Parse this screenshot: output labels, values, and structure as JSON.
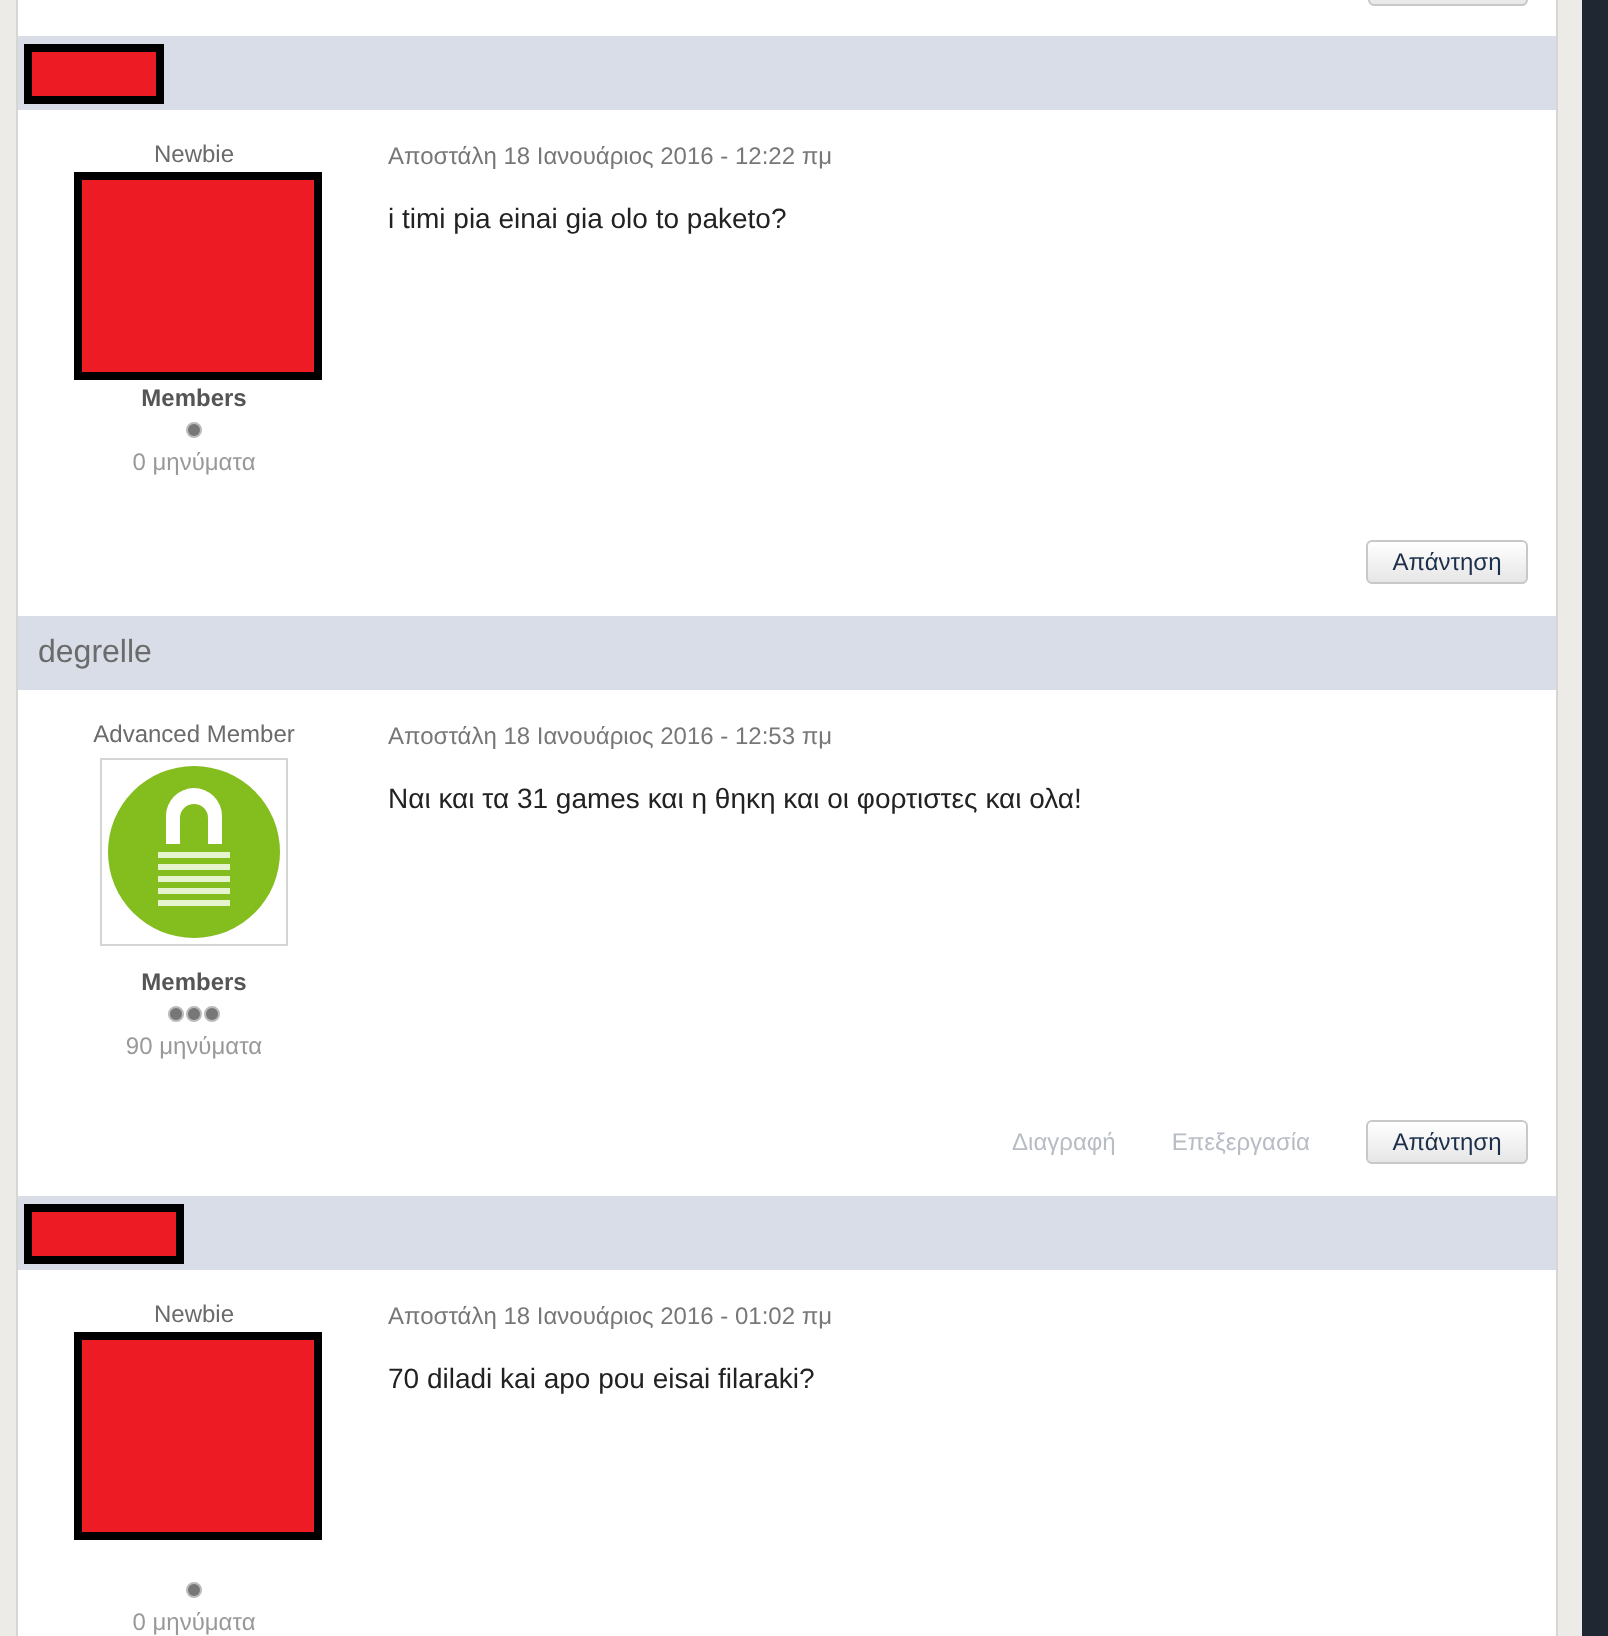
{
  "posts": [
    {
      "author": {
        "redacted": true
      },
      "rank": "Newbie",
      "avatar": {
        "kind": "redacted"
      },
      "group": "Members",
      "rank_pips": [
        {
          "kind": "dot"
        }
      ],
      "post_count": "0 μηνύματα",
      "timestamp": "Αποστάλη 18 Ιανουάριος 2016 - 12:22 πμ",
      "message": "i timi pia einai gia olo to paketo?",
      "actions": [
        {
          "kind": "button",
          "label": "Απάντηση"
        }
      ]
    },
    {
      "author": {
        "redacted": false,
        "name": "degrelle"
      },
      "rank": "Advanced Member",
      "avatar": {
        "kind": "logo"
      },
      "group": "Members",
      "rank_pips": [
        {
          "kind": "dot"
        },
        {
          "kind": "dot"
        },
        {
          "kind": "dot"
        }
      ],
      "post_count": "90 μηνύματα",
      "timestamp": "Αποστάλη 18 Ιανουάριος 2016 - 12:53 πμ",
      "message": "Ναι και τα 31 games και η θηκη και οι φορτιστες και ολα!",
      "actions": [
        {
          "kind": "link",
          "label": "Διαγραφή"
        },
        {
          "kind": "link",
          "label": "Επεξεργασία"
        },
        {
          "kind": "button",
          "label": "Απάντηση"
        }
      ]
    },
    {
      "author": {
        "redacted": true
      },
      "rank": "Newbie",
      "avatar": {
        "kind": "redacted"
      },
      "rank_pips": [
        {
          "kind": "dot"
        }
      ],
      "post_count": "0 μηνύματα",
      "timestamp": "Αποστάλη 18 Ιανουάριος 2016 - 01:02 πμ",
      "message": "70 diladi kai apo pou eisai filaraki?"
    }
  ]
}
